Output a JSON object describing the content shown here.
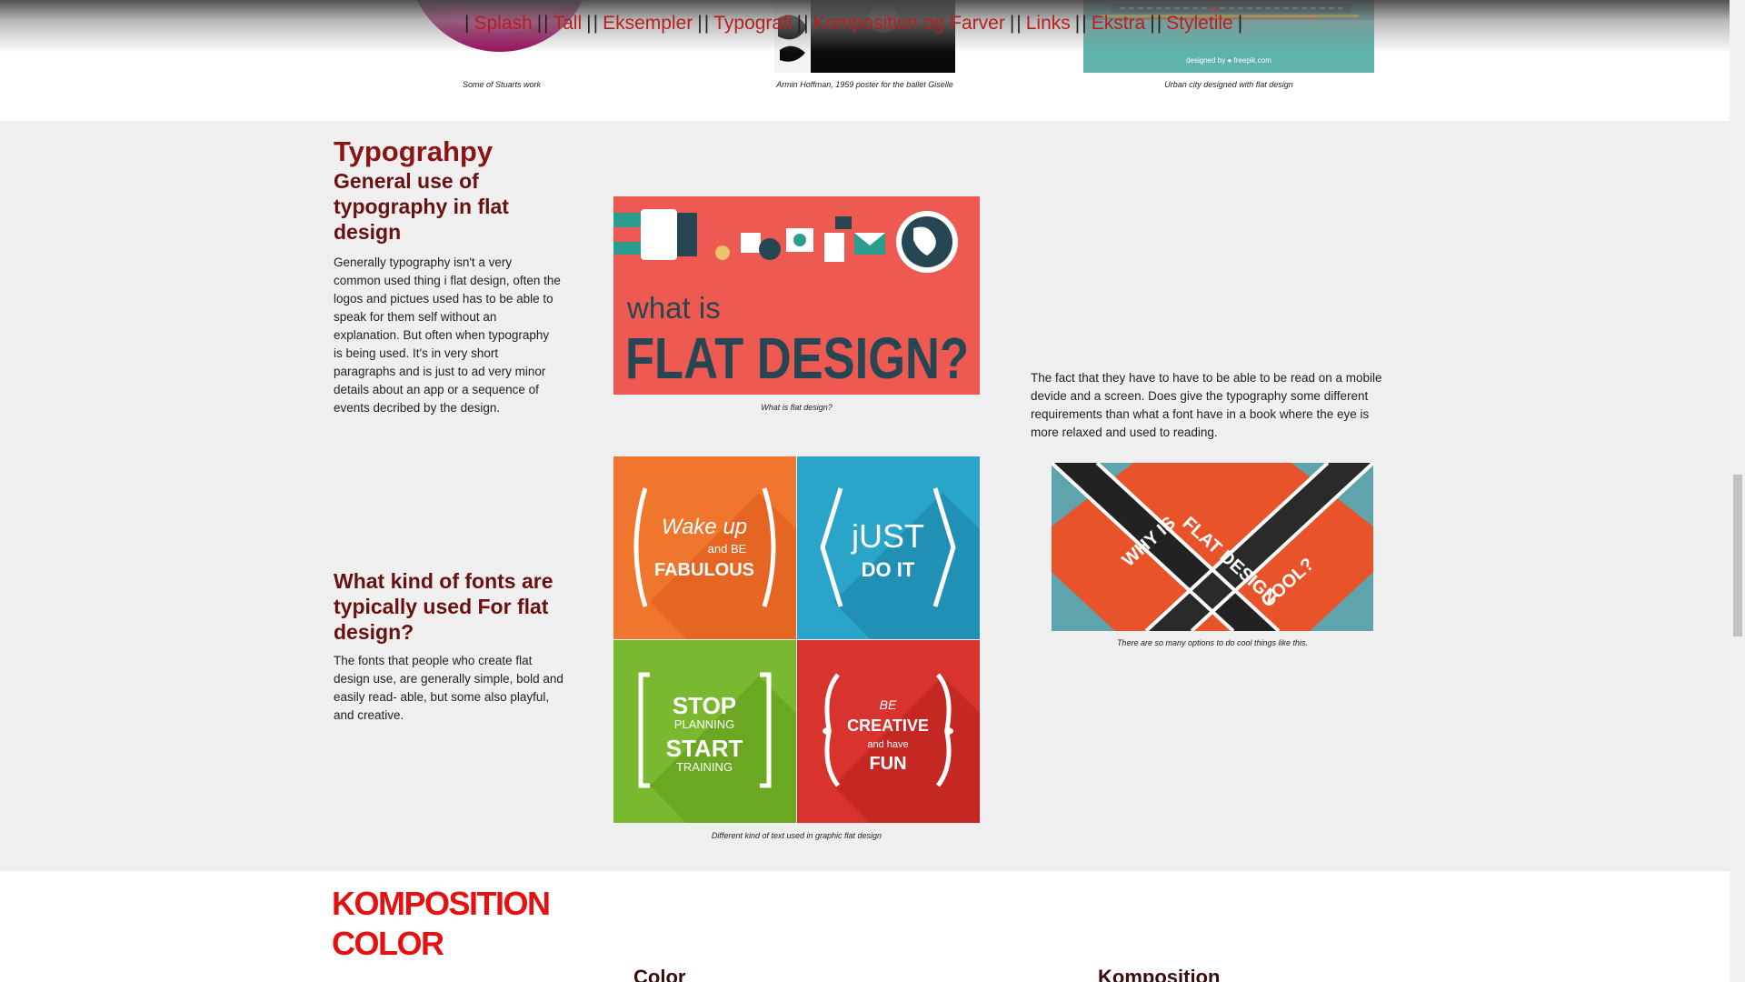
{
  "nav": {
    "items": [
      "Splash",
      "Tall",
      "Eksempler",
      "Typografi",
      "Komposition og Farver",
      "Links",
      "Ekstra",
      "Styletile"
    ],
    "separator": "|"
  },
  "gallery_top": {
    "captions": [
      "Some of Stuarts work",
      "Armin Hoffman, 1959 poster for the ballet Giselle",
      "Urban city designed with flat design"
    ],
    "freepik_label": "designed by ● freepik.com"
  },
  "typography": {
    "title": "Typograhpy",
    "general_heading": "General use of typography in flat design",
    "general_text": "Generally typography isn't a very common used thing i flat design, often the logos and pictues used has to be able to speak for them self without an explanation. But often when typography is being used. It's in very short paragraphs and is just to ad very minor details about an app or a sequence of events decribed by the design.",
    "fonts_heading": "What kind of fonts are typically used For flat design?",
    "fonts_text": "The fonts that people who create flat design use, are generally simple, bold and easily read- able, but some also playful, and creative.",
    "right_text": "The fact that they have to have to be able to be read on a mobile devide and a screen. Does give the typography some different requirements than what a font have in a book where the eye is more relaxed and used to reading.",
    "img1": {
      "small": "what is",
      "big": "FLAT DESIGN?",
      "caption": "What is flat design?"
    },
    "img2": {
      "tiles": [
        {
          "line1": "Wake up",
          "line2": "and BE",
          "line3": "FABULOUS"
        },
        {
          "line1": "jUST",
          "line2": "DO IT"
        },
        {
          "line1": "STOP",
          "line2": "PLANNING",
          "line3": "START",
          "line4": "TRAINING"
        },
        {
          "line1": "BE",
          "line2": "CREATIVE",
          "line3": "and have",
          "line4": "FUN"
        }
      ],
      "caption": "Different kind of text used in graphic flat design"
    },
    "img3": {
      "line1": "WHY IS",
      "line2": "FLAT DESIGN",
      "line3": "COOL?",
      "caption": "There are so many options to do cool things like this."
    }
  },
  "komposition": {
    "title_line1": "KOMPOSITION",
    "title_line2": "COLOR",
    "color_heading": "Color",
    "komp_heading": "Komposition"
  },
  "colors": {
    "nav_link": "#b81f1f",
    "section_bg": "#efefef",
    "heading_dark_red": "#8b1414",
    "komp_red": "#e51010"
  }
}
